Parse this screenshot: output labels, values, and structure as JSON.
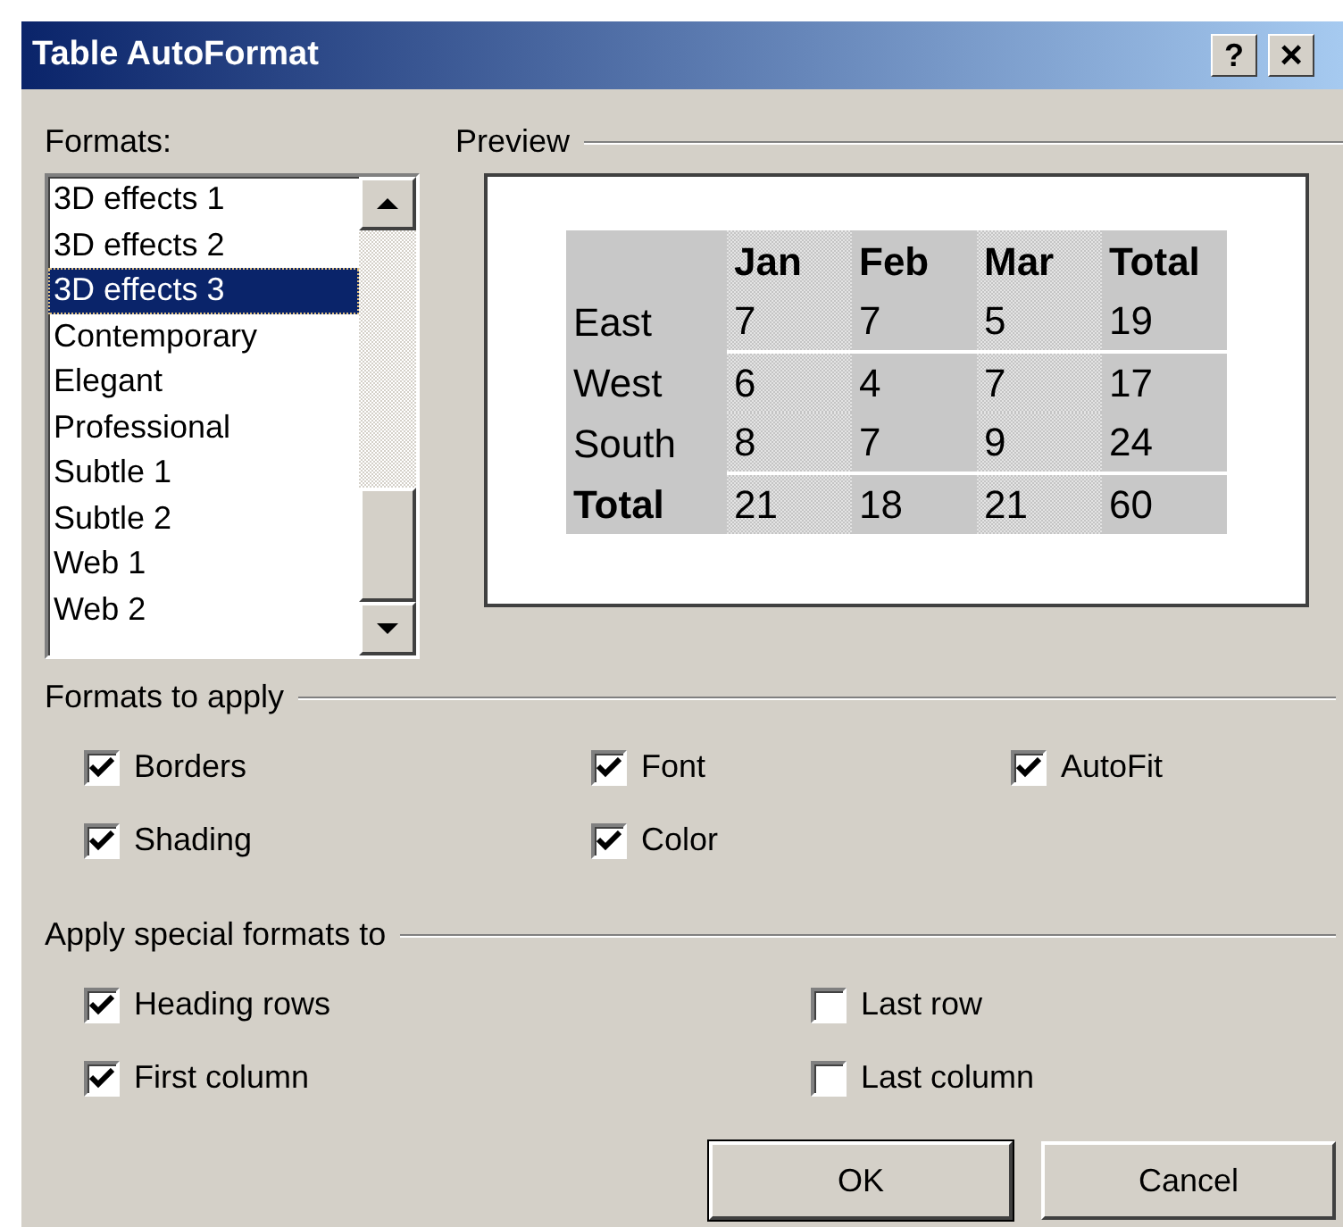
{
  "window": {
    "title": "Table AutoFormat",
    "title_buttons": [
      {
        "kind": "help",
        "label": "?"
      },
      {
        "kind": "close",
        "label": "×"
      }
    ]
  },
  "formats": {
    "label": "Formats:",
    "items": [
      {
        "label": "3D effects 1",
        "selected": false
      },
      {
        "label": "3D effects 2",
        "selected": false
      },
      {
        "label": "3D effects 3",
        "selected": true
      },
      {
        "label": "Contemporary",
        "selected": false
      },
      {
        "label": "Elegant",
        "selected": false
      },
      {
        "label": "Professional",
        "selected": false
      },
      {
        "label": "Subtle 1",
        "selected": false
      },
      {
        "label": "Subtle 2",
        "selected": false
      },
      {
        "label": "Web 1",
        "selected": false
      },
      {
        "label": "Web 2",
        "selected": false
      }
    ]
  },
  "preview": {
    "title": "Preview",
    "table": {
      "header": [
        "Jan",
        "Feb",
        "Mar",
        "Total"
      ],
      "rows": [
        {
          "label": "East",
          "emphasized": false,
          "values": [
            "7",
            "7",
            "5",
            "19"
          ]
        },
        {
          "label": "West",
          "emphasized": false,
          "values": [
            "6",
            "4",
            "7",
            "17"
          ]
        },
        {
          "label": "South",
          "emphasized": false,
          "values": [
            "8",
            "7",
            "9",
            "24"
          ]
        },
        {
          "label": "Total",
          "emphasized": true,
          "values": [
            "21",
            "18",
            "21",
            "60"
          ]
        }
      ]
    }
  },
  "formats_to_apply": {
    "title": "Formats to apply",
    "options": [
      {
        "label": "Borders",
        "checked": true
      },
      {
        "label": "Font",
        "checked": true
      },
      {
        "label": "AutoFit",
        "checked": true
      },
      {
        "label": "Shading",
        "checked": true
      },
      {
        "label": "Color",
        "checked": true
      }
    ]
  },
  "special_formats": {
    "title": "Apply special formats to",
    "options": [
      {
        "label": "Heading rows",
        "checked": true
      },
      {
        "label": "Last row",
        "checked": false
      },
      {
        "label": "First column",
        "checked": true
      },
      {
        "label": "Last column",
        "checked": false
      }
    ]
  },
  "buttons": [
    {
      "label": "OK",
      "default": true
    },
    {
      "label": "Cancel",
      "default": false
    }
  ]
}
